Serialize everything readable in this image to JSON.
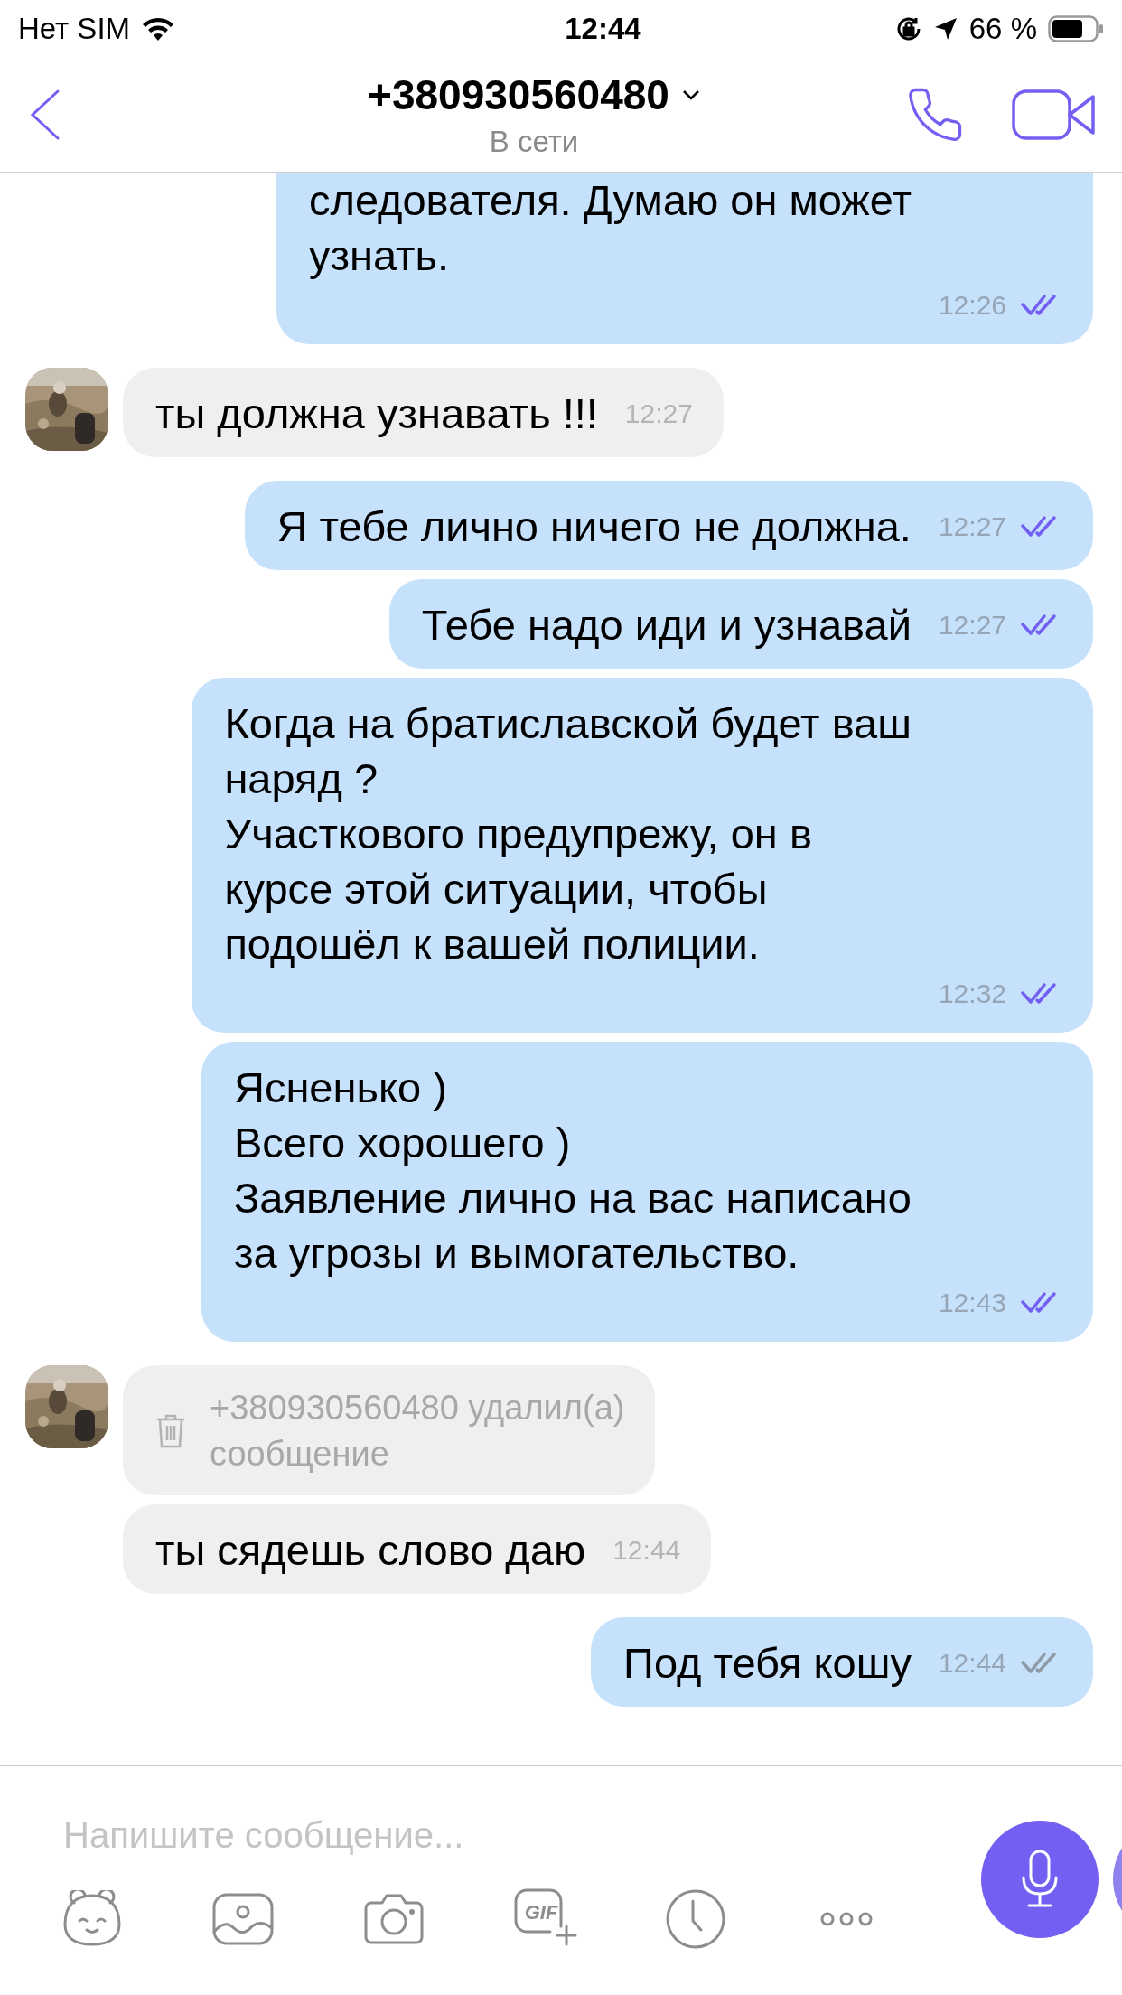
{
  "status_bar": {
    "carrier": "Нет SIM",
    "time": "12:44",
    "battery": "66 %"
  },
  "header": {
    "title": "+380930560480",
    "status": "В сети"
  },
  "messages": [
    {
      "outgoing": true,
      "kind": "text",
      "cut": true,
      "text": "следователя. Думаю он может\nузнать.",
      "time": "12:26",
      "read": true
    },
    {
      "outgoing": false,
      "kind": "text",
      "avatar": true,
      "text": "ты должна узнавать !!!",
      "time": "12:27"
    },
    {
      "outgoing": true,
      "kind": "text",
      "text": "Я тебе лично ничего не должна.",
      "time": "12:27",
      "read": true
    },
    {
      "outgoing": true,
      "kind": "text",
      "text": "Тебе надо иди и узнавай",
      "time": "12:27",
      "read": true
    },
    {
      "outgoing": true,
      "kind": "text",
      "text": "Когда на братиславской будет ваш\nнаряд ?\nУчасткового предупрежу, он в\nкурсе этой ситуации, чтобы\nподошёл к вашей полиции.",
      "time": "12:32",
      "read": true
    },
    {
      "outgoing": true,
      "kind": "text",
      "text": "Ясненько )\nВсего хорошего )\nЗаявление лично на вас написано\nза угрозы и вымогательство.",
      "time": "12:43",
      "read": true
    },
    {
      "outgoing": false,
      "kind": "deleted",
      "avatar": true,
      "text": "+380930560480 удалил(а)\nсообщение"
    },
    {
      "outgoing": false,
      "kind": "text",
      "avatar": false,
      "text": "ты сядешь слово даю",
      "time": "12:44"
    },
    {
      "outgoing": true,
      "kind": "text",
      "text": "Под тебя кошу",
      "time": "12:44",
      "read": false
    }
  ],
  "composer": {
    "placeholder": "Напишите сообщение...",
    "gif_label": "GIF"
  }
}
